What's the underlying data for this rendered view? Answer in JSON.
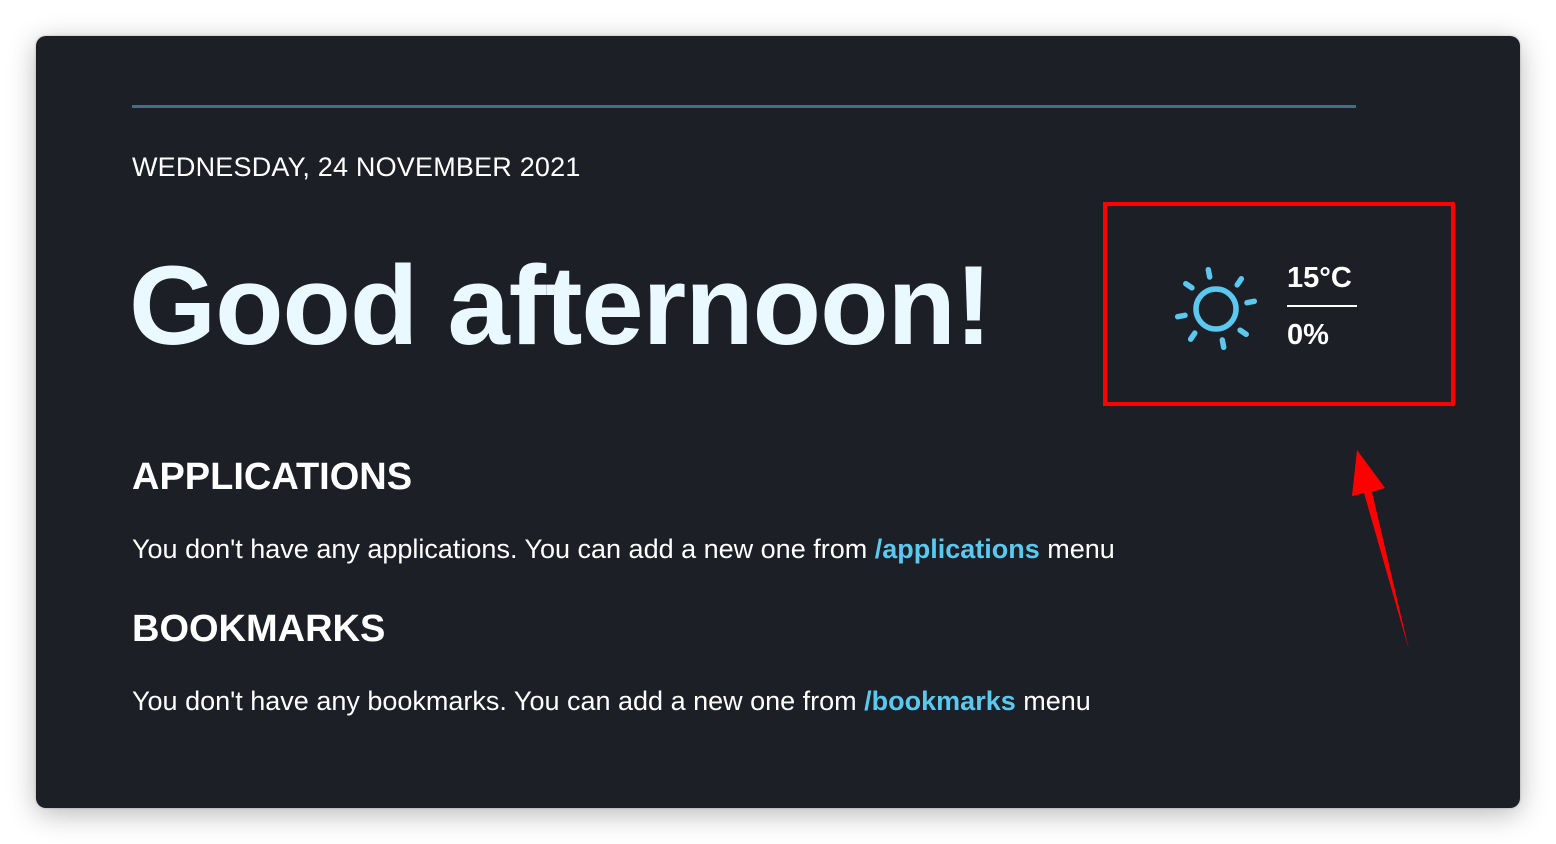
{
  "header": {
    "date": "WEDNESDAY, 24 NOVEMBER 2021",
    "greeting": "Good afternoon!"
  },
  "weather": {
    "icon": "sun-icon",
    "icon_color": "#5bc8f0",
    "temperature": "15°C",
    "humidity": "0%"
  },
  "applications": {
    "heading": "APPLICATIONS",
    "text_before": "You don't have any applications. You can add a new one from ",
    "link_label": "/applications",
    "text_after": " menu"
  },
  "bookmarks": {
    "heading": "BOOKMARKS",
    "text_before": "You don't have any bookmarks. You can add a new one from ",
    "link_label": "/bookmarks",
    "text_after": " menu"
  },
  "colors": {
    "background": "#1c1f26",
    "accent": "#5bc8f0",
    "rule": "#3d7283",
    "annotation": "#ff0000"
  }
}
